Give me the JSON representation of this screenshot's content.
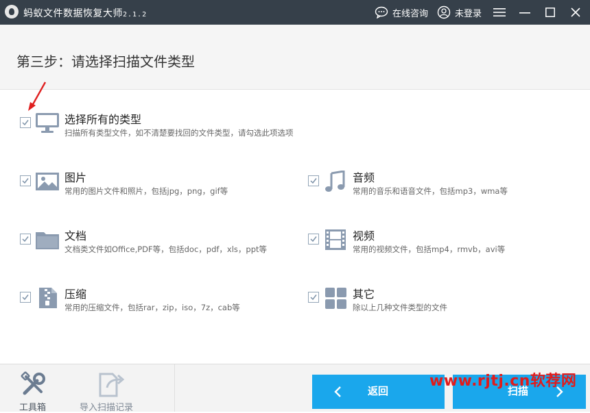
{
  "window": {
    "title": "蚂蚁文件数据恢复大师",
    "version": "2.1.2",
    "online_help": "在线咨询",
    "login": "未登录"
  },
  "step": {
    "title": "第三步：请选择扫描文件类型"
  },
  "options": {
    "all": {
      "title": "选择所有的类型",
      "desc": "扫描所有类型文件，如不清楚要找回的文件类型，请勾选此项选项",
      "checked": true
    },
    "image": {
      "title": "图片",
      "desc": "常用的图片文件和照片，包括jpg，png，gif等",
      "checked": true
    },
    "audio": {
      "title": "音频",
      "desc": "常用的音乐和语音文件，包括mp3，wma等",
      "checked": true
    },
    "doc": {
      "title": "文档",
      "desc": "文档类文件如Office,PDF等，包括doc，pdf，xls，ppt等",
      "checked": true
    },
    "video": {
      "title": "视频",
      "desc": "常用的视频文件，包括mp4，rmvb，avi等",
      "checked": true
    },
    "zip": {
      "title": "压缩",
      "desc": "常用的压缩文件，包括rar，zip，iso，7z，cab等",
      "checked": true
    },
    "other": {
      "title": "其它",
      "desc": "除以上几种文件类型的文件",
      "checked": true
    }
  },
  "bottom": {
    "toolbox": "工具箱",
    "import_record": "导入扫描记录",
    "back": "返回",
    "scan": "扫描"
  },
  "watermark": "www.rjtj.cn软荐网",
  "colors": {
    "titlebar": "#36404a",
    "accent": "#1aa7ec",
    "icon": "#8a9aaf",
    "arrow": "#e02020"
  }
}
